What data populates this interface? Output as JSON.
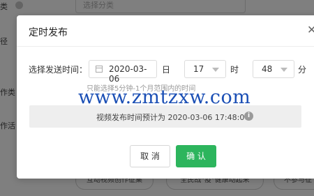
{
  "background": {
    "labels": [
      "类",
      "径",
      "作类",
      "作活"
    ],
    "category_placeholder": "选择分类",
    "chips": [
      "互动视频创作征集",
      "全民战\"疫\"健康动起来",
      "不参与征"
    ]
  },
  "dialog": {
    "title": "定时发布",
    "close_glyph": "✕",
    "time_label": "选择发送时间：",
    "date_value": "2020-03-06",
    "day_unit": "日",
    "hour_value": "17",
    "hour_unit": "时",
    "minute_value": "48",
    "minute_unit": "分",
    "hint": "只能选择5分钟-1个月范围内的时间",
    "estimate_text": "视频发布时间预计为 2020-03-06 17:48:00",
    "info_glyph": "i",
    "cancel_label": "取 消",
    "confirm_label": "确 认"
  },
  "watermark": "www.zmtzxw.com",
  "colors": {
    "confirm": "#2db55d",
    "overlay": "rgba(0,0,0,0.5)",
    "watermark": "#1b4fb5"
  }
}
